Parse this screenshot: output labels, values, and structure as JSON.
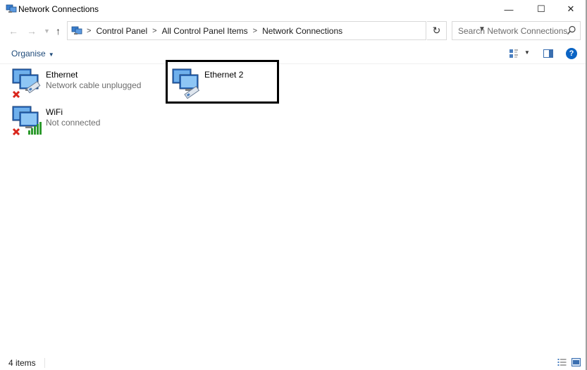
{
  "window": {
    "title": "Network Connections"
  },
  "titlebar": {
    "minimize_glyph": "—",
    "maximize_glyph": "☐",
    "close_glyph": "✕"
  },
  "nav": {
    "back_glyph": "←",
    "forward_glyph": "→",
    "recent_glyph": "▼",
    "up_glyph": "↑"
  },
  "address": {
    "crumbs": [
      "Control Panel",
      "All Control Panel Items",
      "Network Connections"
    ],
    "separator": ">",
    "dropdown_glyph": "▼",
    "refresh_glyph": "↻"
  },
  "search": {
    "placeholder": "Search Network Connections"
  },
  "toolbar": {
    "organise_label": "Organise",
    "organise_caret": "▼",
    "view_caret": "▼",
    "help_label": "?"
  },
  "connections": [
    {
      "name": "Ethernet",
      "status": "Network cable unplugged",
      "icon": "ethernet-disconnected-icon"
    },
    {
      "name": "Ethernet 2",
      "status": "",
      "icon": "ethernet-icon"
    },
    {
      "name": "WiFi",
      "status": "Not connected",
      "icon": "wifi-disconnected-icon"
    }
  ],
  "statusbar": {
    "item_count": "4 items"
  },
  "colors": {
    "accent": "#0b64c4",
    "error_red": "#d9261c",
    "signal_green": "#2e9a2e",
    "highlight_border": "#000000"
  }
}
